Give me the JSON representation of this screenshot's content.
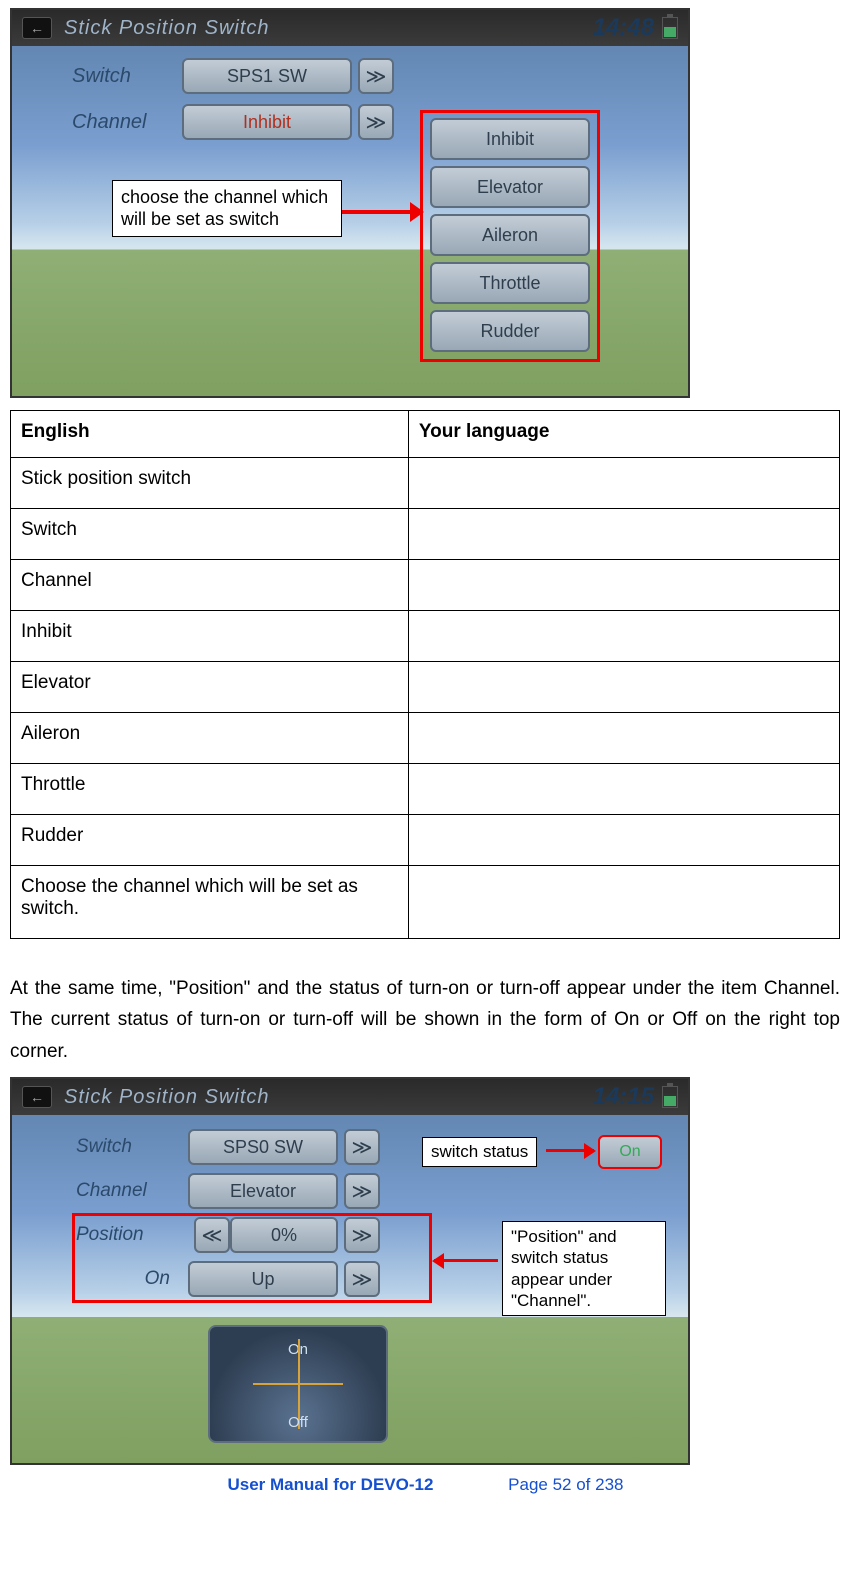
{
  "shot1": {
    "title": "Stick Position Switch",
    "time": "14:48",
    "rows": {
      "switch_label": "Switch",
      "switch_value": "SPS1 SW",
      "channel_label": "Channel",
      "channel_value": "Inhibit"
    },
    "tooltip": "choose the channel which will be set as switch",
    "dropdown": [
      "Inhibit",
      "Elevator",
      "Aileron",
      "Throttle",
      "Rudder"
    ]
  },
  "table": {
    "headers": [
      "English",
      "Your language"
    ],
    "rows": [
      "Stick position switch",
      "Switch",
      "Channel",
      "Inhibit",
      "Elevator",
      "Aileron",
      "Throttle",
      "Rudder",
      "Choose the channel which will be set as switch."
    ]
  },
  "paragraph": "At the same time, \"Position\" and the status of turn-on or turn-off appear under the item Channel. The current status of turn-on or turn-off will be shown in the form of On or Off on the right top corner.",
  "shot2": {
    "title": "Stick Position Switch",
    "time": "14:15",
    "status_value": "On",
    "rows": {
      "switch_label": "Switch",
      "switch_value": "SPS0 SW",
      "channel_label": "Channel",
      "channel_value": "Elevator",
      "position_label": "Position",
      "position_value": "0%",
      "on_label": "On",
      "on_value": "Up"
    },
    "tooltip_status": "switch status",
    "tooltip_pos": "\"Position\" and switch status appear under \"Channel\".",
    "gauge": {
      "on": "On",
      "off": "Off"
    }
  },
  "footer": {
    "title": "User Manual for DEVO-12",
    "page": "Page 52 of 238"
  }
}
